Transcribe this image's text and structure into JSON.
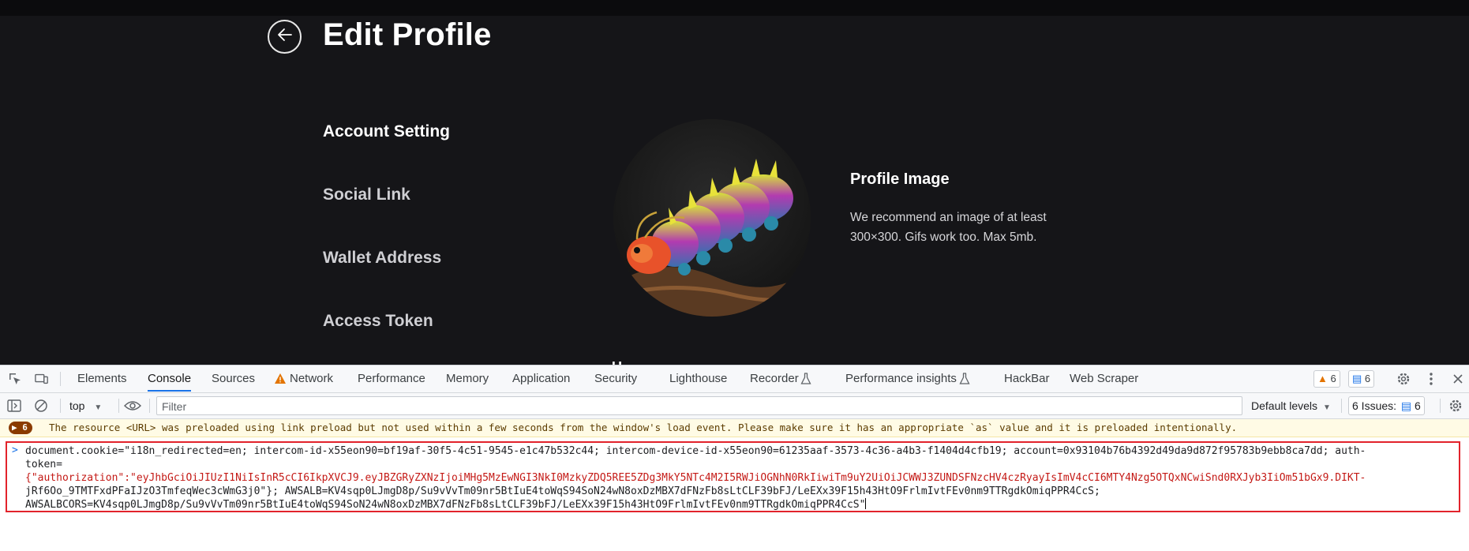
{
  "page": {
    "title": "Edit Profile",
    "nav": [
      "Account Setting",
      "Social Link",
      "Wallet Address",
      "Access Token"
    ],
    "profile_image_title": "Profile Image",
    "profile_image_desc": "We recommend an image of at least 300×300. Gifs work too. Max 5mb.",
    "cut_off_text": "U"
  },
  "devtools": {
    "tabs": [
      "Elements",
      "Console",
      "Sources",
      "Network",
      "Performance",
      "Memory",
      "Application",
      "Security",
      "Lighthouse",
      "Recorder",
      "Performance insights",
      "HackBar",
      "Web Scraper"
    ],
    "active_tab": "Console",
    "warning_count": "6",
    "message_count": "6",
    "context": "top",
    "filter_placeholder": "Filter",
    "levels": "Default levels",
    "issues_label": "6 Issues:",
    "issues_count": "6",
    "warning_badge": "6",
    "warning_message": "The resource <URL> was preloaded using link preload but not used within a few seconds from the window's load event. Please make sure it has an appropriate `as` value and it is preloaded intentionally.",
    "console_lines": [
      "document.cookie=\"i18n_redirected=en; intercom-id-x55eon90=bf19af-30f5-4c51-9545-e1c47b532c44; intercom-device-id-x55eon90=61235aaf-3573-4c36-a4b3-f1404d4cfb19; account=0x93104b76b4392d49da9d872f95783b9ebb8ca7dd; auth-",
      "token=",
      "{\"authorization\":\"eyJhbGciOiJIUzI1NiIsInR5cCI6IkpXVCJ9.eyJBZGRyZXNzIjoiMHg5MzEwNGI3NkI0MzkyZDQ5REE5ZDg3MkY5NTc4M2I5RWJiOGNhN0RkIiwiTm9uY2UiOiJCWWJ3ZUNDSFNzcHV4czRyayIsImV4cCI6MTY4Nzg5OTQxNCwiSnd0RXJyb3IiOm51bGx9.DIKT-",
      "jRf6Oo_9TMTFxdPFaIJzO3TmfeqWec3cWmG3j0\"}; AWSALB=KV4sqp0LJmgD8p/Su9vVvTm09nr5BtIuE4toWqS94SoN24wN8oxDzMBX7dFNzFb8sLtCLF39bFJ/LeEXx39F15h43HtO9FrlmIvtFEv0nm9TTRgdkOmiqPPR4CcS;",
      "AWSALBCORS=KV4sqp0LJmgD8p/Su9vVvTm09nr5BtIuE4toWqS94SoN24wN8oxDzMBX7dFNzFb8sLtCLF39bFJ/LeEXx39F15h43HtO9FrlmIvtFEv0nm9TTRgdkOmiqPPR4CcS\""
    ]
  },
  "colors": {
    "page_bg": "#151518",
    "highlight_border": "#e2232b",
    "accent_blue": "#1a73e8",
    "string_red": "#c41a16"
  },
  "icons": [
    "arrow-left-icon",
    "inspect-element-icon",
    "device-toolbar-icon",
    "warning-icon",
    "flask-icon",
    "sidebar-icon",
    "clear-console-icon",
    "eye-icon",
    "gear-icon",
    "more-vert-icon",
    "close-icon",
    "chat-icon"
  ]
}
